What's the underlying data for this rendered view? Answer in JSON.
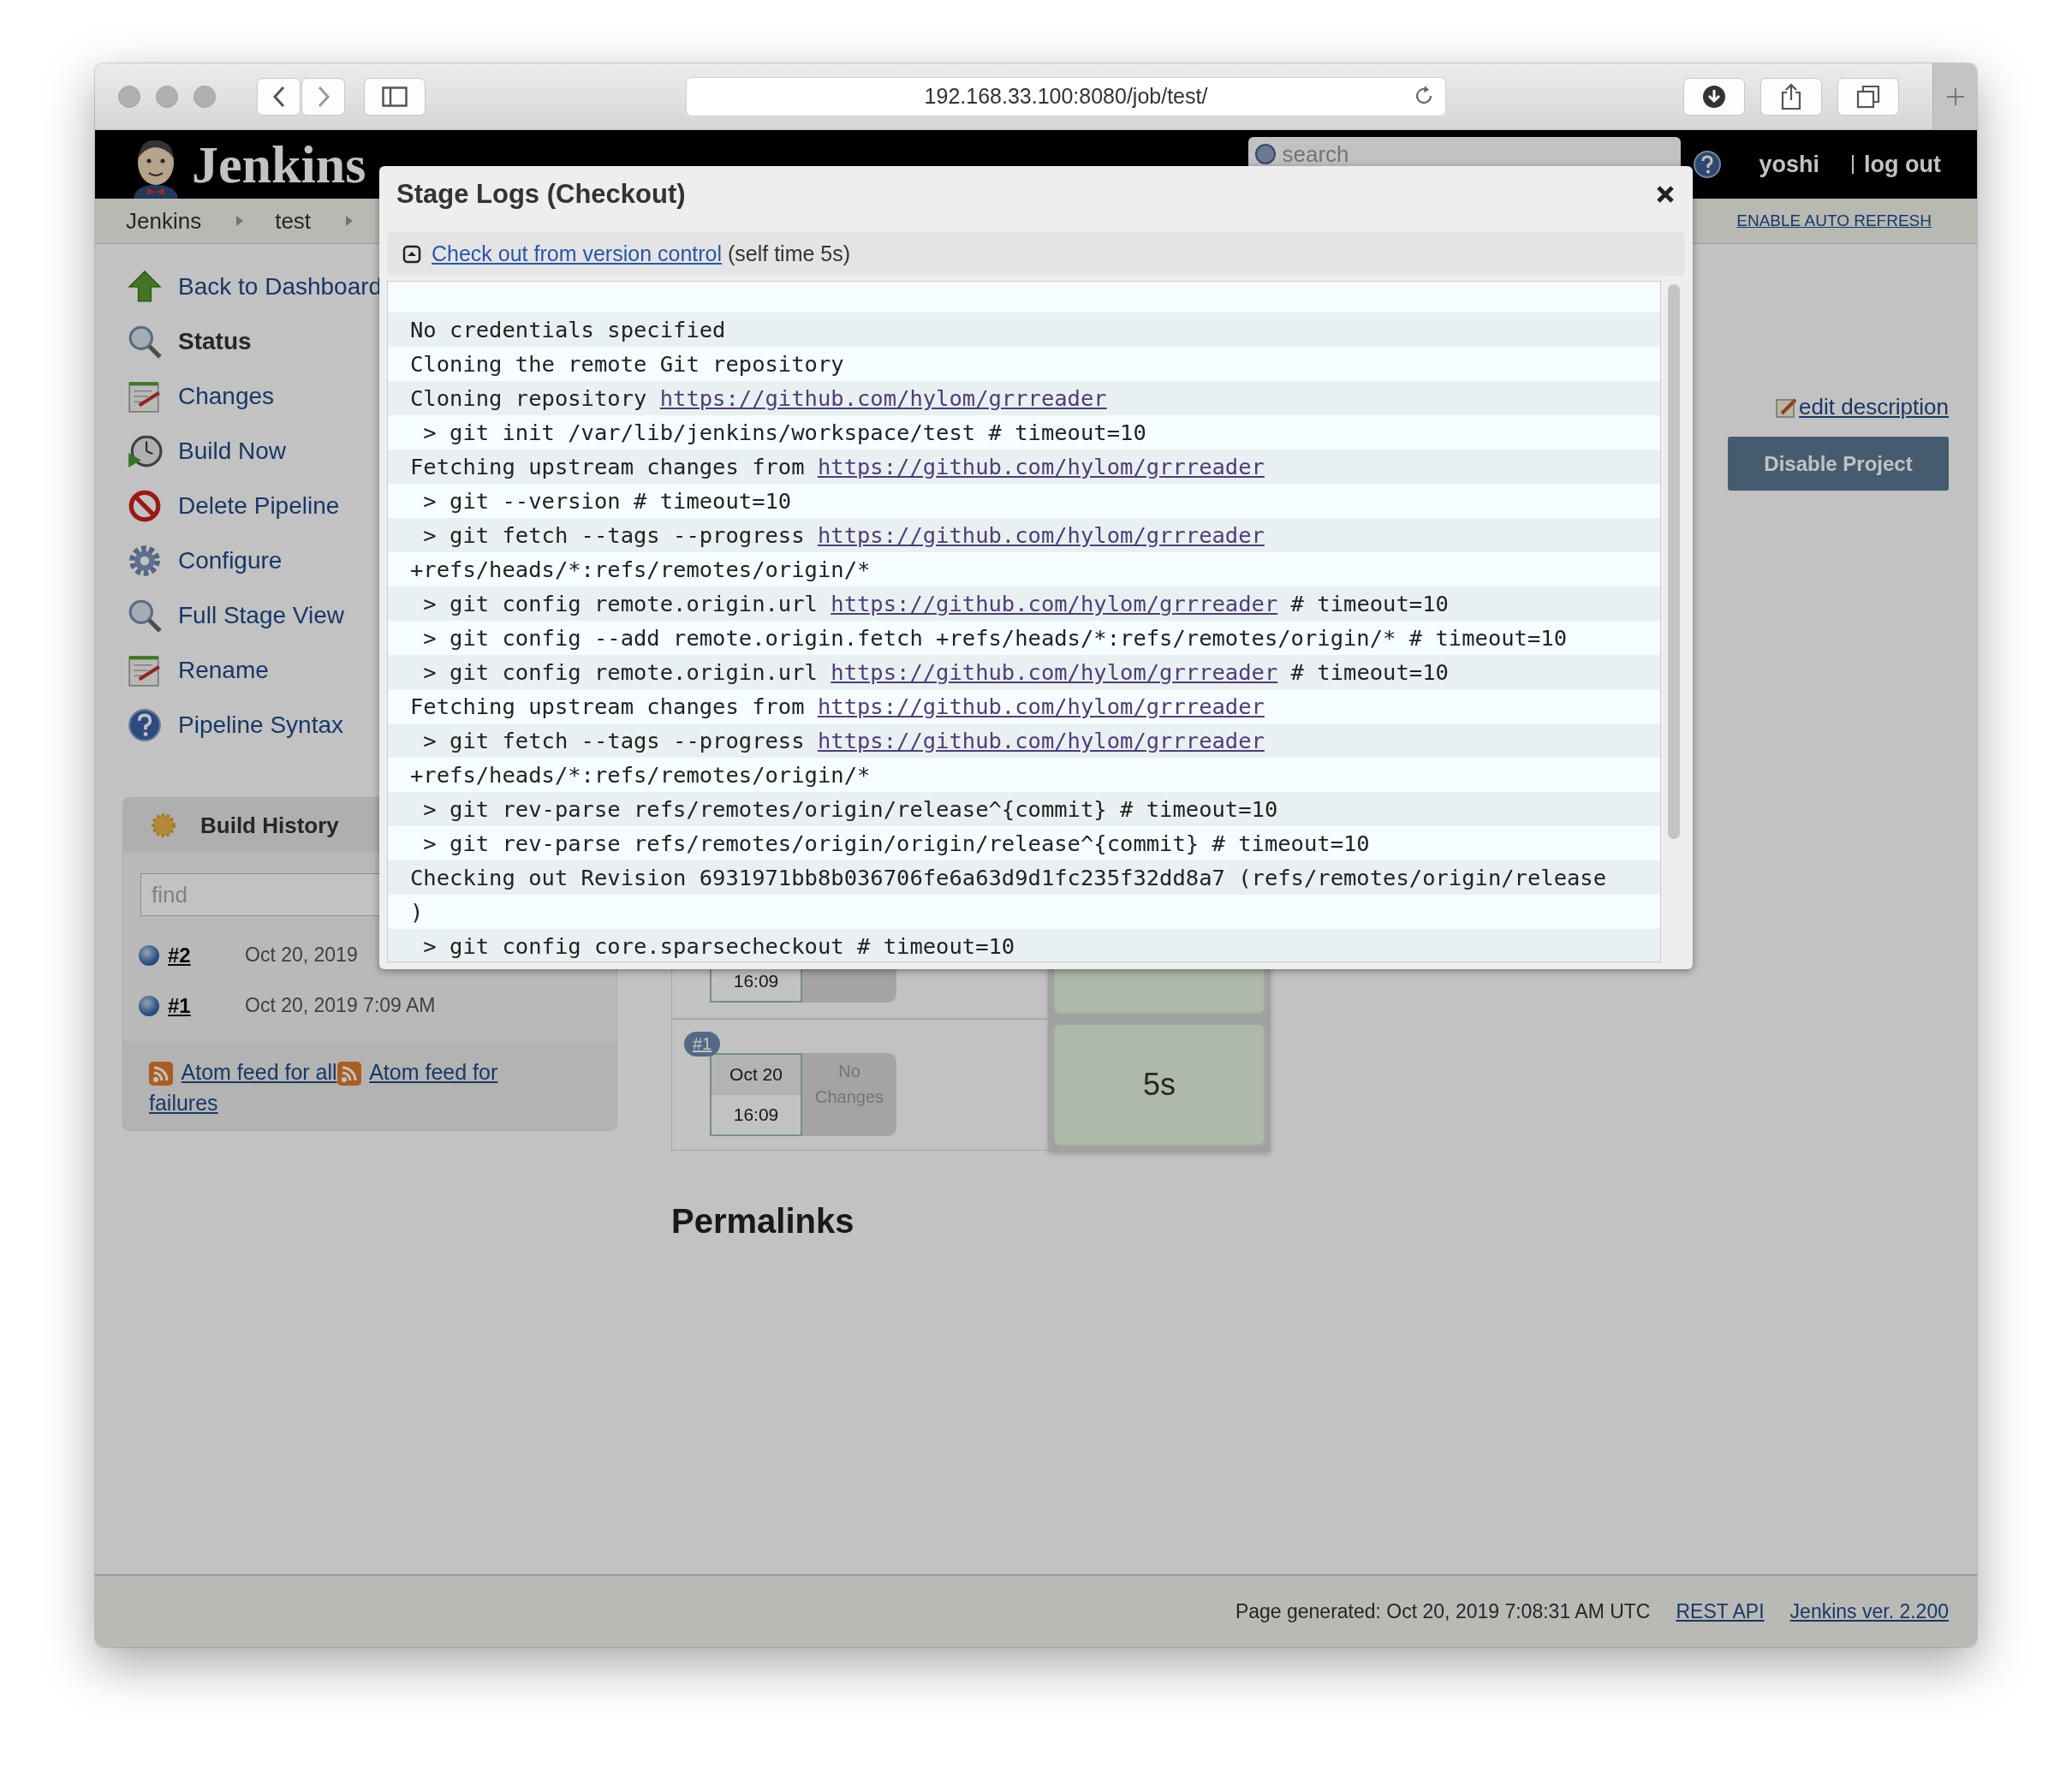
{
  "browser": {
    "url": "192.168.33.100:8080/job/test/"
  },
  "header": {
    "logo_text": "Jenkins",
    "search_placeholder": "search",
    "user": "yoshi",
    "logout": "log out"
  },
  "breadcrumbs": [
    "Jenkins",
    "test"
  ],
  "auto_refresh": "ENABLE AUTO REFRESH",
  "sidebar": {
    "items": [
      {
        "label": "Back to Dashboard",
        "kind": "dashboard",
        "selected": false
      },
      {
        "label": "Status",
        "kind": "status",
        "selected": true
      },
      {
        "label": "Changes",
        "kind": "changes",
        "selected": false
      },
      {
        "label": "Build Now",
        "kind": "build",
        "selected": false
      },
      {
        "label": "Delete Pipeline",
        "kind": "delete",
        "selected": false
      },
      {
        "label": "Configure",
        "kind": "configure",
        "selected": false
      },
      {
        "label": "Full Stage View",
        "kind": "status",
        "selected": false
      },
      {
        "label": "Rename",
        "kind": "changes",
        "selected": false
      },
      {
        "label": "Pipeline Syntax",
        "kind": "help",
        "selected": false
      }
    ]
  },
  "build_history": {
    "title": "Build History",
    "find_placeholder": "find",
    "builds": [
      {
        "number": "#2",
        "date": "Oct 20, 2019"
      },
      {
        "number": "#1",
        "date": "Oct 20, 2019 7:09 AM"
      }
    ],
    "feeds": [
      "Atom feed for all",
      "Atom feed for failures"
    ]
  },
  "edit_description": "edit description",
  "disable_button": "Disable Project",
  "stage_view": {
    "runs": [
      {
        "time": "16:09"
      },
      {
        "badge": "#1",
        "date": "Oct 20",
        "time": "16:09",
        "changes": "No Changes",
        "duration": "5s"
      }
    ]
  },
  "permalinks": "Permalinks",
  "footer": {
    "generated": "Page generated: Oct 20, 2019 7:08:31 AM UTC",
    "rest_api": "REST API",
    "version": "Jenkins ver. 2.200"
  },
  "modal": {
    "title": "Stage Logs (Checkout)",
    "step_link": "Check out from version control",
    "step_time": "(self time 5s)",
    "log": [
      {
        "text": "No credentials specified"
      },
      {
        "text": "Cloning the remote Git repository"
      },
      {
        "text": "Cloning repository ",
        "link": "https://github.com/hylom/grrreader"
      },
      {
        "text": " > git init /var/lib/jenkins/workspace/test # timeout=10"
      },
      {
        "text": "Fetching upstream changes from ",
        "link": "https://github.com/hylom/grrreader"
      },
      {
        "text": " > git --version # timeout=10"
      },
      {
        "text": " > git fetch --tags --progress ",
        "link": "https://github.com/hylom/grrreader"
      },
      {
        "text": "+refs/heads/*:refs/remotes/origin/*"
      },
      {
        "text": " > git config remote.origin.url ",
        "link": "https://github.com/hylom/grrreader",
        "rest": " # timeout=10"
      },
      {
        "text": " > git config --add remote.origin.fetch +refs/heads/*:refs/remotes/origin/* # timeout=10"
      },
      {
        "text": " > git config remote.origin.url ",
        "link": "https://github.com/hylom/grrreader",
        "rest": " # timeout=10"
      },
      {
        "text": "Fetching upstream changes from ",
        "link": "https://github.com/hylom/grrreader"
      },
      {
        "text": " > git fetch --tags --progress ",
        "link": "https://github.com/hylom/grrreader"
      },
      {
        "text": "+refs/heads/*:refs/remotes/origin/*"
      },
      {
        "text": " > git rev-parse refs/remotes/origin/release^{commit} # timeout=10"
      },
      {
        "text": " > git rev-parse refs/remotes/origin/origin/release^{commit} # timeout=10"
      },
      {
        "text": "Checking out Revision 6931971bb8b036706fe6a63d9d1fc235f32dd8a7 (refs/remotes/origin/release"
      },
      {
        "text": ")"
      },
      {
        "text": " > git config core.sparsecheckout # timeout=10"
      }
    ]
  }
}
